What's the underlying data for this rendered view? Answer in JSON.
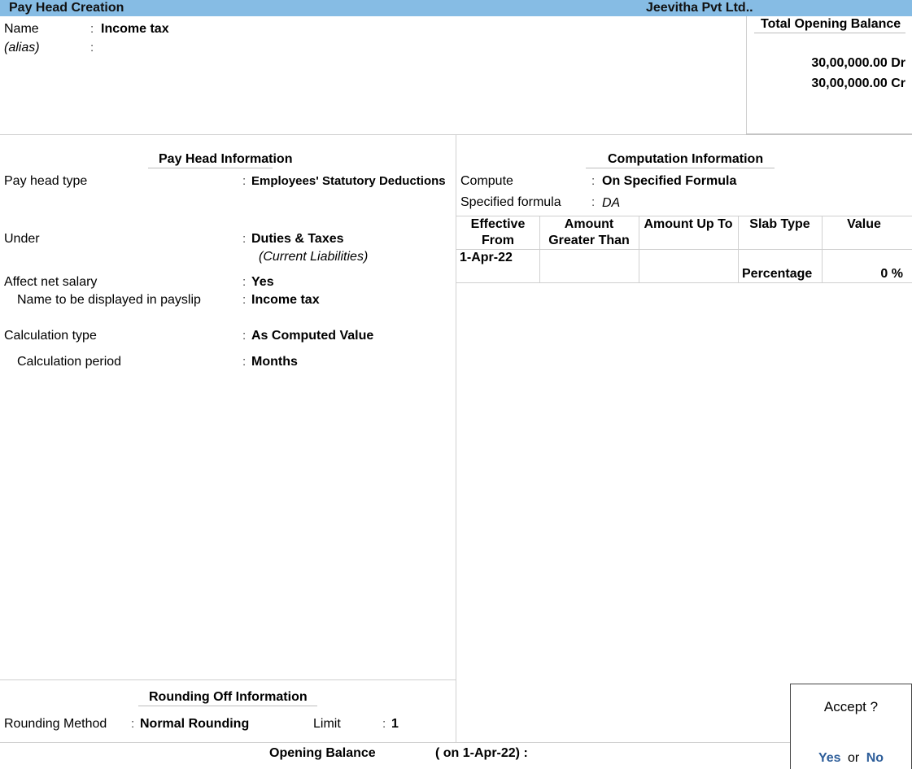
{
  "titlebar": {
    "title": "Pay Head  Creation",
    "company": "Jeevitha Pvt Ltd.."
  },
  "header": {
    "name_label": "Name",
    "name_value": "Income tax",
    "alias_label": "(alias)",
    "alias_value": "",
    "colon": ":"
  },
  "opening_balance_panel": {
    "title": "Total Opening Balance",
    "debit": "30,00,000.00 Dr",
    "credit": "30,00,000.00 Cr"
  },
  "pay_head_info": {
    "title": "Pay Head Information",
    "fields": [
      {
        "label": "Pay head type",
        "value": "Employees' Statutory Deductions"
      },
      {
        "label": "Under",
        "value": "Duties & Taxes",
        "sub": "(Current Liabilities)"
      },
      {
        "label": "Affect net salary",
        "value": "Yes"
      },
      {
        "label": "Name to be displayed in payslip",
        "value": "Income tax"
      },
      {
        "label": "Calculation type",
        "value": "As Computed Value"
      },
      {
        "label": "Calculation period",
        "value": "Months"
      }
    ]
  },
  "computation_info": {
    "title": "Computation Information",
    "compute_label": "Compute",
    "compute_value": "On Specified Formula",
    "formula_label": "Specified formula",
    "formula_value": "DA",
    "table": {
      "headers": [
        "Effective\nFrom",
        "Amount\nGreater Than",
        "Amount Up To",
        "Slab Type",
        "Value"
      ],
      "header_lines": [
        [
          "Effective",
          "From"
        ],
        [
          "Amount",
          "Greater Than"
        ],
        [
          "Amount Up To"
        ],
        [
          "Slab Type"
        ],
        [
          "Value"
        ]
      ],
      "rows": [
        {
          "effective_from": "1-Apr-22",
          "amount_greater_than": "",
          "amount_up_to": "",
          "slab_type": "Percentage",
          "value": "0 %"
        }
      ]
    }
  },
  "rounding_info": {
    "title": "Rounding Off Information",
    "method_label": "Rounding Method",
    "method_value": "Normal Rounding",
    "limit_label": "Limit",
    "limit_value": "1"
  },
  "footer": {
    "opening_balance_label": "Opening Balance",
    "opening_balance_date": "( on 1-Apr-22)  :",
    "opening_balance_value": ""
  },
  "accept_dialog": {
    "question": "Accept ?",
    "yes": "Yes",
    "or": "or",
    "no": "No"
  }
}
